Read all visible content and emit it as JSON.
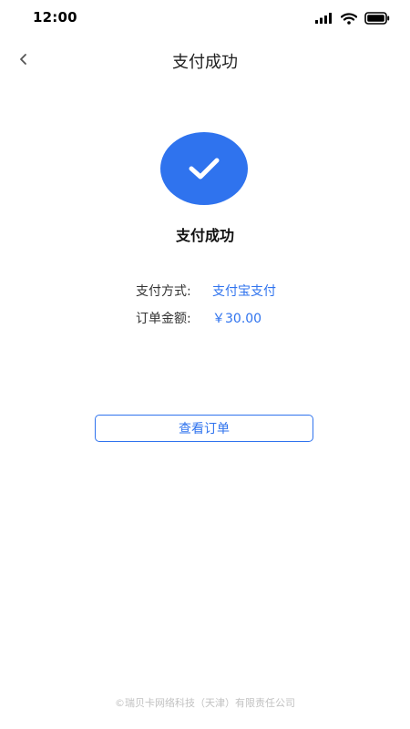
{
  "status_bar": {
    "time": "12:00",
    "icons": [
      "signal-icon",
      "wifi-icon",
      "battery-icon"
    ]
  },
  "nav": {
    "back_icon": "chevron-left-icon",
    "title": "支付成功"
  },
  "success": {
    "icon": "check-icon",
    "title": "支付成功"
  },
  "details": {
    "method_label": "支付方式:",
    "method_value": "支付宝支付",
    "amount_label": "订单金额:",
    "amount_value": "￥30.00"
  },
  "actions": {
    "view_order_label": "查看订单"
  },
  "footer": {
    "copyright": "©瑞贝卡网络科技（天津）有限责任公司"
  },
  "colors": {
    "accent": "#2f73ee",
    "footer_text": "#c2c2c2"
  }
}
